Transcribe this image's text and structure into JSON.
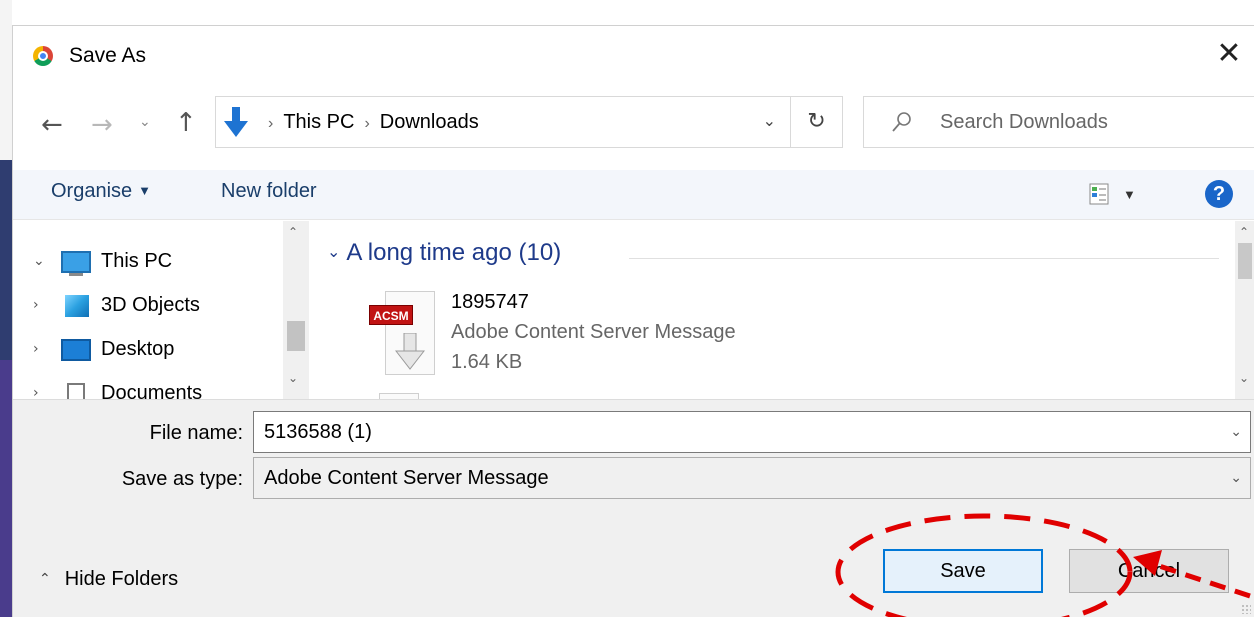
{
  "window": {
    "title": "Save As",
    "close_glyph": "✕",
    "app_icon": "chrome-icon"
  },
  "nav": {
    "back_glyph": "←",
    "forward_glyph": "→",
    "recent_glyph": "⌄",
    "up_glyph": "↑",
    "path": [
      "This PC",
      "Downloads"
    ],
    "path_separator": "›",
    "dropdown_glyph": "⌄",
    "refresh_glyph": "↻",
    "search_placeholder": "Search Downloads"
  },
  "toolbar": {
    "organise_label": "Organise",
    "caret": "▼",
    "new_folder_label": "New folder",
    "help_label": "?"
  },
  "tree": {
    "expanded_chev": "⌄",
    "collapsed_chev": "›",
    "items": [
      {
        "label": "This PC",
        "icon": "computer-icon"
      },
      {
        "label": "3D Objects",
        "icon": "cube-icon"
      },
      {
        "label": "Desktop",
        "icon": "desktop-icon"
      },
      {
        "label": "Documents",
        "icon": "document-icon"
      }
    ]
  },
  "content": {
    "group_label": "A long time ago (10)",
    "group_chev": "⌄",
    "files": [
      {
        "name": "1895747",
        "type": "Adobe Content Server Message",
        "size": "1.64 KB",
        "badge": "ACSM"
      }
    ]
  },
  "form": {
    "file_name_label": "File name:",
    "file_name_value": "5136588 (1)",
    "save_type_label": "Save as type:",
    "save_type_value": "Adobe Content Server Message",
    "dropdown_chev": "⌄"
  },
  "footer": {
    "hide_folders_label": "Hide Folders",
    "hide_chev": "⌃",
    "save_label": "Save",
    "cancel_label": "Cancel"
  },
  "scroll": {
    "up_glyph": "⌃",
    "down_glyph": "⌄"
  },
  "colors": {
    "accent": "#0078d7",
    "annotation": "#e00000",
    "link_text": "#1a3e6a"
  }
}
